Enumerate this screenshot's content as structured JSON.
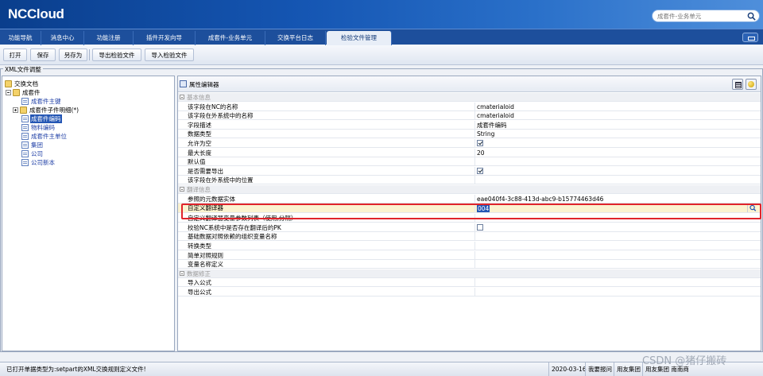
{
  "app": {
    "logo": "NCCloud"
  },
  "search": {
    "placeholder": "成套件-业务单元"
  },
  "tabs": [
    {
      "label": "功能导航"
    },
    {
      "label": "消息中心"
    },
    {
      "label": "功能注册"
    },
    {
      "label": "插件开发向导"
    },
    {
      "label": "成套件-业务单元"
    },
    {
      "label": "交换平台日志"
    },
    {
      "label": "检验文件管理",
      "active": true
    }
  ],
  "toolbar": {
    "open": "打开",
    "save": "保存",
    "save_as": "另存为",
    "export": "导出检验文件",
    "import": "导入检验文件"
  },
  "group_title": "XML文件调整",
  "tree": {
    "root": "交换文档",
    "node1": "成套件",
    "n_main_key": "成套件主键",
    "n_child": "成套件子件明细(*)",
    "n_code": "成套件编码",
    "n_material": "物料编码",
    "n_main_unit": "成套件主单位",
    "n_group": "集团",
    "n_company": "公司",
    "n_company_ver": "公司新本"
  },
  "editor": {
    "title": "属性编辑器",
    "rows": [
      {
        "type": "cat",
        "key": "基本信息"
      },
      {
        "key": "该字段在NC的名称",
        "value": "cmaterialoid"
      },
      {
        "key": "该字段在外系统中的名称",
        "value": "cmaterialoid"
      },
      {
        "key": "字段描述",
        "value": "成套件编码"
      },
      {
        "key": "数据类型",
        "value": "String"
      },
      {
        "key": "允许为空",
        "check": true
      },
      {
        "key": "最大长度",
        "value": "20"
      },
      {
        "key": "默认值",
        "value": ""
      },
      {
        "key": "是否需要导出",
        "check": true
      },
      {
        "key": "该字段在外系统中的位置",
        "value": ""
      },
      {
        "type": "cat",
        "key": "翻译信息"
      },
      {
        "key": "参照的元数据实体",
        "value": "eae040f4-3c88-413d-abc9-b15774463d46"
      },
      {
        "type": "hl",
        "key": "自定义翻译器",
        "value": "004"
      },
      {
        "key": "自定义翻译器变量参数列表（使用,分隔）",
        "value": ""
      },
      {
        "key": "校验NC系统中是否存在翻译后的PK",
        "check": false
      },
      {
        "key": "基础数据对照依赖的组织变量名称",
        "value": ""
      },
      {
        "key": "转换类型",
        "value": ""
      },
      {
        "key": "简单对照规则",
        "value": ""
      },
      {
        "key": "变量名称定义",
        "value": ""
      },
      {
        "type": "cat",
        "key": "数据修正"
      },
      {
        "key": "导入公式",
        "value": ""
      },
      {
        "key": "导出公式",
        "value": ""
      }
    ]
  },
  "status": {
    "message": "已打开单据类型为:setpart的XML交换规则定义文件!",
    "date": "2020-03-16",
    "user": "我要报问",
    "group": "用友集团",
    "org": "用友集团 南南商"
  },
  "watermark": "CSDN @猪仔搬砖",
  "colors": {
    "banner": "#1556b3",
    "selection": "#2456b4",
    "highlight_border": "#e0242b"
  }
}
